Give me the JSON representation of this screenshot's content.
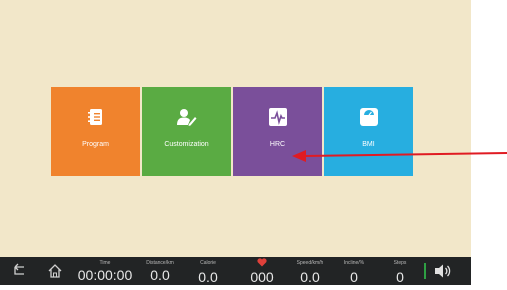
{
  "colors": {
    "background": "#f2e7c9",
    "program": "#f0832d",
    "customization": "#5aab43",
    "hrc": "#7a4f9a",
    "bmi": "#27aee0",
    "status_bar": "#222425",
    "arrow": "#e01b22",
    "heart": "#e0403a"
  },
  "tiles": [
    {
      "label": "Program",
      "icon": "notebook-icon"
    },
    {
      "label": "Customization",
      "icon": "user-edit-icon"
    },
    {
      "label": "HRC",
      "icon": "heart-rate-icon"
    },
    {
      "label": "BMI",
      "icon": "scale-icon"
    }
  ],
  "status_bar": {
    "back_icon": "back-icon",
    "home_icon": "home-icon",
    "volume_icon": "volume-icon",
    "metrics": {
      "time": {
        "label": "Time",
        "value": "00:00:00"
      },
      "distance": {
        "label": "Distance/km",
        "value": "0.0"
      },
      "calorie": {
        "label": "Calorie",
        "value": "0.0"
      },
      "heart_rate": {
        "icon": "heart-icon",
        "value": "000"
      },
      "speed": {
        "label": "Speed/km/h",
        "value": "0.0"
      },
      "incline": {
        "label": "Incline/%",
        "value": "0"
      },
      "steps": {
        "label": "Steps",
        "value": "0"
      }
    }
  }
}
